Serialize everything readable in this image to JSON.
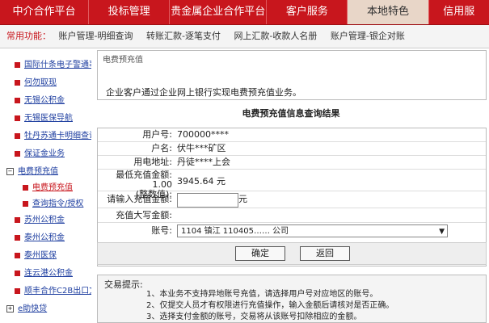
{
  "nav": {
    "tabs": [
      {
        "label": "中介合作平台"
      },
      {
        "label": "投标管理"
      },
      {
        "label": "贵金属企业合作平台"
      },
      {
        "label": "客户服务"
      },
      {
        "label": "本地特色"
      },
      {
        "label": "信用服"
      }
    ]
  },
  "quick": {
    "label": "常用功能：",
    "items": [
      {
        "label": "账户管理-明细查询"
      },
      {
        "label": "转账汇款-逐笔支付"
      },
      {
        "label": "网上汇款-收款人名册"
      },
      {
        "label": "账户管理-银企对账"
      }
    ]
  },
  "sidebar": {
    "items": [
      {
        "label": "国际什条电子警通事件"
      },
      {
        "label": "何勿取现"
      },
      {
        "label": "无锡公积金"
      },
      {
        "label": "无锡医保导航"
      },
      {
        "label": "牡丹苏通卡明细查询"
      },
      {
        "label": "保证金业务"
      },
      {
        "label": "电费预充值"
      },
      {
        "label": "电费预充值"
      },
      {
        "label": "查询指令/授权"
      },
      {
        "label": "苏州公积金"
      },
      {
        "label": "泰州公积金"
      },
      {
        "label": "泰州医保"
      },
      {
        "label": "连云港公积金"
      },
      {
        "label": "顺丰合作C2B出口文单"
      },
      {
        "label": "e助快贷"
      }
    ]
  },
  "main": {
    "breadcrumb": "电费预充值",
    "description": "企业客户通过企业网上银行实现电费预充值业务。",
    "title": "电费预充值信息查询结果",
    "fields": {
      "user_no_label": "用户号:",
      "user_no": "700000****",
      "name_label": "户名:",
      "name": "伏牛***矿区",
      "address_label": "用电地址:",
      "address": "丹徒****上会",
      "min_label1": "最低充值金额:",
      "min_label1b": "1.00",
      "min_label2": "(整数值):",
      "min_value": "3945.64 元",
      "input_label": "请输入充值金额:",
      "input_unit": "元",
      "upper_label": "充值大写金额:",
      "account_label": "账号:",
      "account_value": "1104 镇江 110405…… 公司"
    },
    "buttons": {
      "confirm": "确定",
      "back": "返回"
    }
  },
  "tips": {
    "head": "交易提示:",
    "lines": [
      "1、本业务不支持异地账号充值，请选择用户号对应地区的账号。",
      "2、仅提交人员才有权限进行充值操作，输入金额后请核对是否正确。",
      "3、选择支付金额的账号，交易将从该账号扣除相应的金额。"
    ]
  },
  "colors": {
    "brand_red": "#c8161d",
    "active_tab": "#e8d6c8"
  }
}
